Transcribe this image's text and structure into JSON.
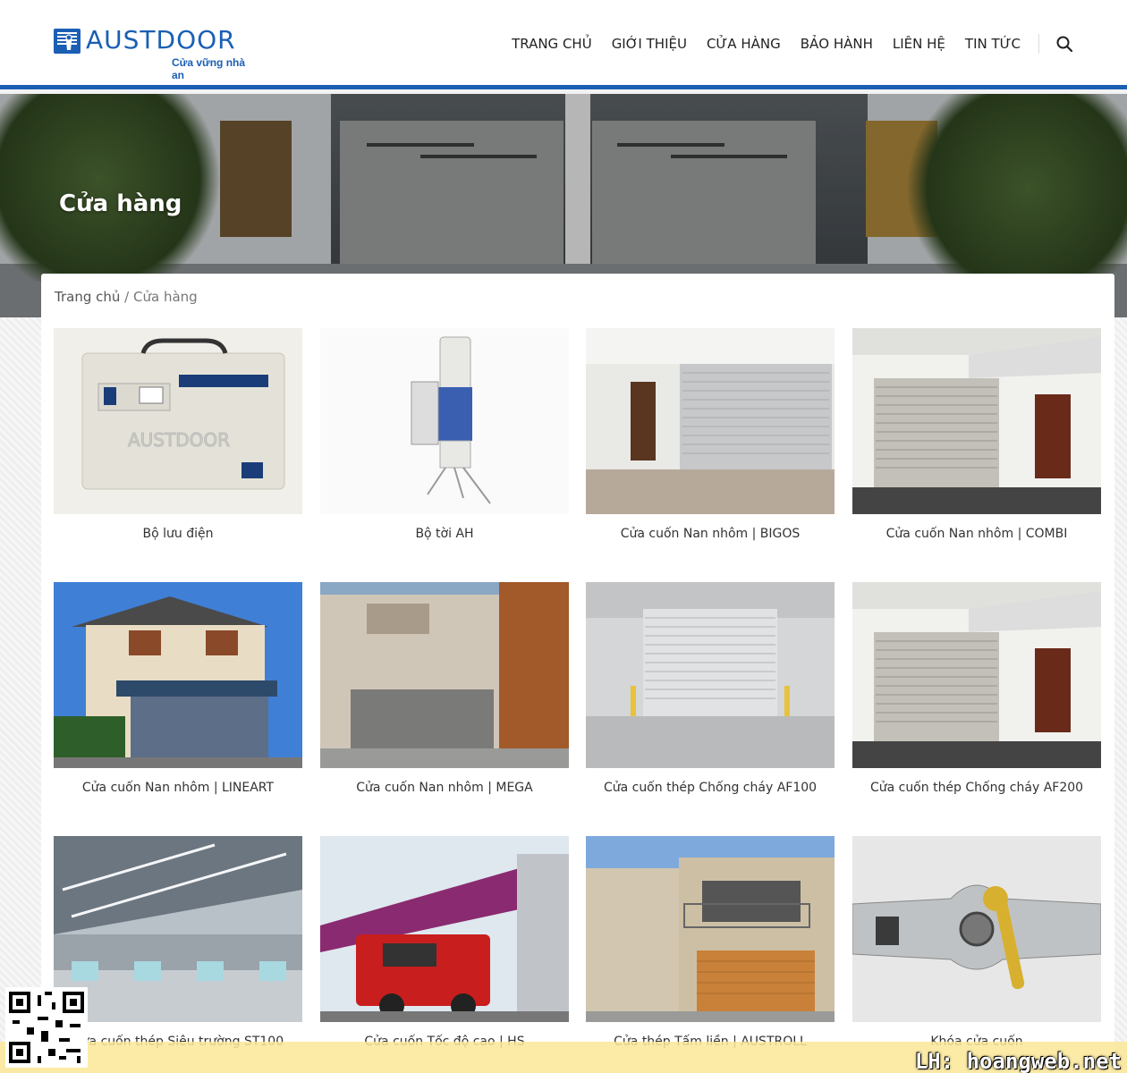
{
  "brand": {
    "name": "AUSTDOOR",
    "tagline": "Cửa vững nhà an"
  },
  "nav": {
    "items": [
      "TRANG CHỦ",
      "GIỚI THIỆU",
      "CỬA HÀNG",
      "BẢO HÀNH",
      "LIÊN HỆ",
      "TIN TỨC"
    ]
  },
  "hero": {
    "title": "Cửa hàng"
  },
  "breadcrumb": {
    "home": "Trang chủ",
    "separator": "/",
    "current": "Cửa hàng"
  },
  "products": [
    {
      "name": "Bộ lưu điện",
      "image": "ups-box"
    },
    {
      "name": "Bộ tời AH",
      "image": "motor"
    },
    {
      "name": "Cửa cuốn Nan nhôm | BIGOS",
      "image": "garage-white"
    },
    {
      "name": "Cửa cuốn Nan nhôm | COMBI",
      "image": "house-shutter"
    },
    {
      "name": "Cửa cuốn Nan nhôm | LINEART",
      "image": "house-blue"
    },
    {
      "name": "Cửa cuốn Nan nhôm | MEGA",
      "image": "modern-house"
    },
    {
      "name": "Cửa cuốn thép Chống cháy AF100",
      "image": "warehouse-door"
    },
    {
      "name": "Cửa cuốn thép Chống cháy AF200",
      "image": "house-shutter"
    },
    {
      "name": "Cửa cuốn thép Siêu trường ST100",
      "image": "factory-hall"
    },
    {
      "name": "Cửa cuốn Tốc độ cao | HS",
      "image": "fire-station"
    },
    {
      "name": "Cửa thép Tấm liền | AUSTROLL",
      "image": "townhouse"
    },
    {
      "name": "Khóa cửa cuốn",
      "image": "lock-keys"
    }
  ],
  "watermark": "LH: hoangweb.net",
  "colors": {
    "brand_blue": "#1a5fb4",
    "page_bg": "#f2f2f2",
    "bottom_bar": "#fae896"
  }
}
